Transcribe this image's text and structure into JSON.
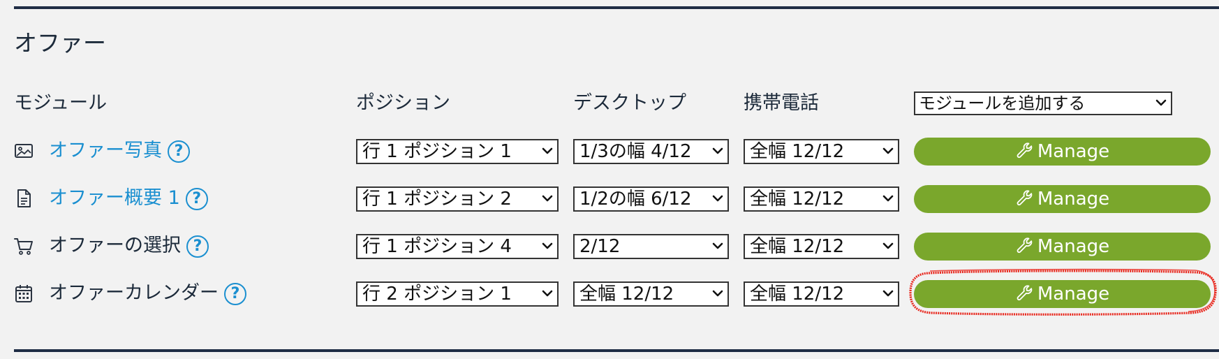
{
  "section": {
    "title": "オファー"
  },
  "headers": {
    "module": "モジュール",
    "position": "ポジション",
    "desktop": "デスクトップ",
    "mobile": "携帯電話",
    "add_module": "モジュールを追加する"
  },
  "rows": [
    {
      "icon": "image-icon",
      "name": "オファー写真",
      "linked": true,
      "help": "?",
      "position": "行 1 ポジション 1",
      "desktop": "1/3の幅 4/12",
      "mobile": "全幅 12/12",
      "action": "Manage"
    },
    {
      "icon": "document-icon",
      "name": "オファー概要 1",
      "linked": true,
      "help": "?",
      "position": "行 1 ポジション 2",
      "desktop": "1/2の幅 6/12",
      "mobile": "全幅 12/12",
      "action": "Manage"
    },
    {
      "icon": "cart-icon",
      "name": "オファーの選択",
      "linked": false,
      "help": "?",
      "position": "行 1 ポジション 4",
      "desktop": "2/12",
      "mobile": "全幅 12/12",
      "action": "Manage"
    },
    {
      "icon": "calendar-icon",
      "name": "オファーカレンダー",
      "linked": false,
      "help": "?",
      "position": "行 2 ポジション 1",
      "desktop": "全幅 12/12",
      "mobile": "全幅 12/12",
      "action": "Manage"
    }
  ],
  "colors": {
    "accent_green": "#7aa72c",
    "link_blue": "#1a8fd0",
    "rule_navy": "#1f2d45",
    "highlight_red": "#e8281e"
  }
}
